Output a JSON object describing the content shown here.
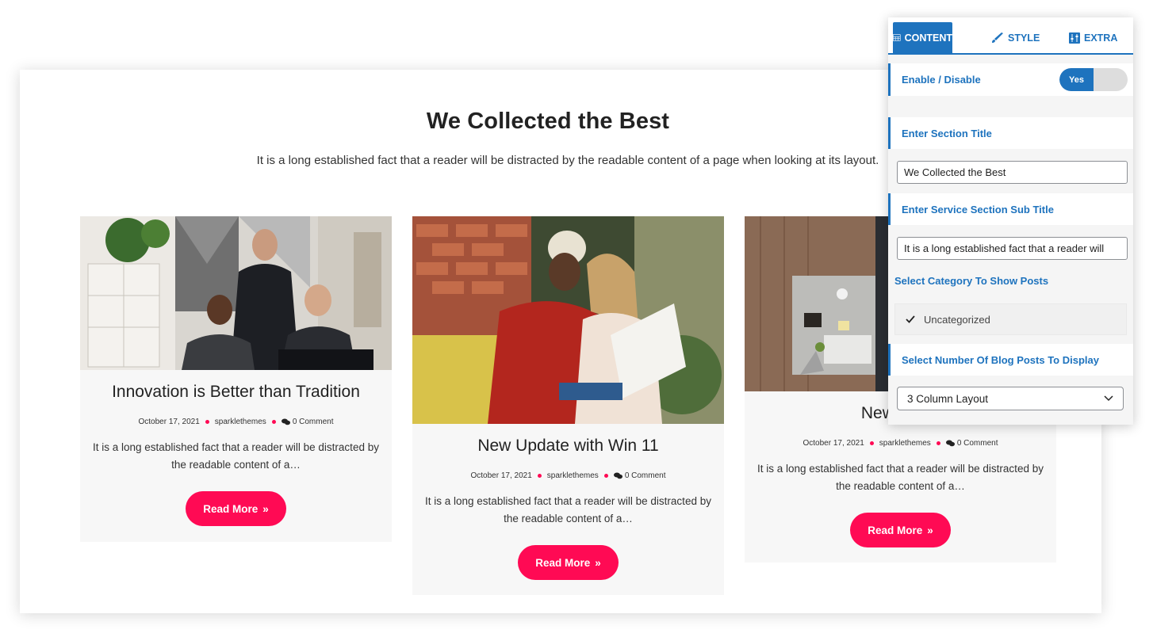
{
  "section": {
    "title": "We Collected the Best",
    "subtitle": "It is a long established fact that a reader will be distracted by the readable content of a page when looking at its layout."
  },
  "posts": [
    {
      "title": "Innovation is Better than Tradition",
      "date": "October 17, 2021",
      "author": "sparklethemes",
      "comments": "0 Comment",
      "excerpt": "It is a long established fact that a reader will be distracted by the readable content of a…",
      "button": "Read More",
      "image": "office-team-photo"
    },
    {
      "title": "New Update with Win 11",
      "date": "October 17, 2021",
      "author": "sparklethemes",
      "comments": "0 Comment",
      "excerpt": "It is a long established fact that a reader will be distracted by the readable content of a…",
      "button": "Read More",
      "image": "colleagues-reading-photo"
    },
    {
      "title": "New Gene",
      "date": "October 17, 2021",
      "author": "sparklethemes",
      "comments": "0 Comment",
      "excerpt": "It is a long established fact that a reader will be distracted by the readable content of a…",
      "button": "Read More",
      "image": "desk-top-view-photo"
    }
  ],
  "panel": {
    "tabs": [
      {
        "label": "CONTENT",
        "icon": "table-icon",
        "active": true
      },
      {
        "label": "STYLE",
        "icon": "brush-icon",
        "active": false
      },
      {
        "label": "EXTRA",
        "icon": "sliders-icon",
        "active": false
      }
    ],
    "enable_label": "Enable / Disable",
    "toggle_value": "Yes",
    "title_label": "Enter Section Title",
    "title_value": "We Collected the Best",
    "subtitle_label": "Enter Service Section Sub Title",
    "subtitle_value": "It is a long established fact that a reader will",
    "category_label": "Select Category To Show Posts",
    "category_option": "Uncategorized",
    "posts_count_label": "Select Number Of Blog Posts To Display",
    "layout_value": "3 Column Layout"
  },
  "colors": {
    "accent_pink": "#ff0a54",
    "accent_blue": "#1e73be"
  }
}
